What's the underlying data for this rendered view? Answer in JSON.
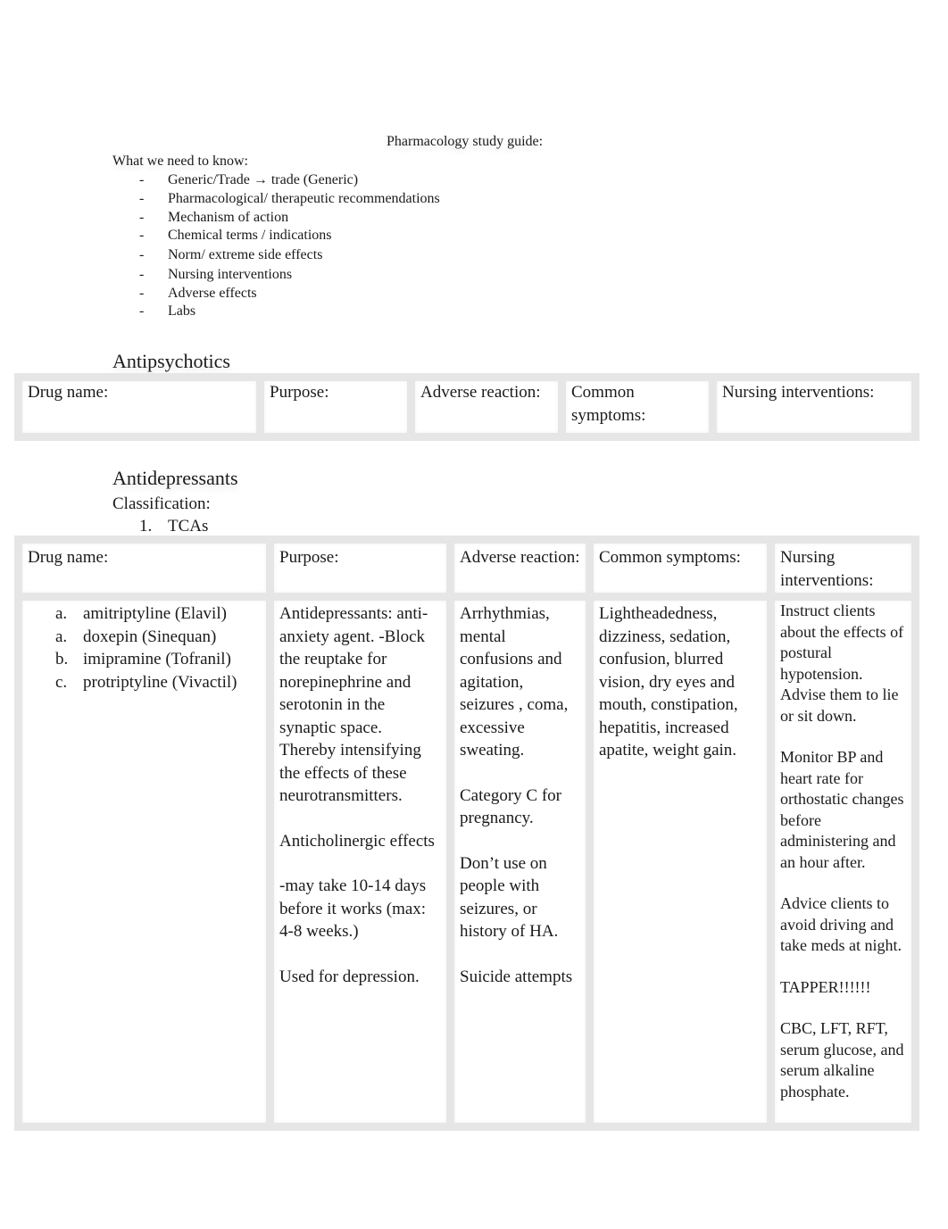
{
  "document": {
    "title": "Pharmacology study guide:",
    "need_heading": "What we need to know:",
    "need_items": [
      {
        "marker": "-",
        "text": "Generic/Trade → trade (Generic)"
      },
      {
        "marker": "-",
        "text": "Pharmacological/ therapeutic recommendations"
      },
      {
        "marker": "-",
        "text": "Mechanism of action"
      },
      {
        "marker": "-",
        "text": "Chemical terms / indications"
      },
      {
        "marker": "-",
        "text": "Norm/ extreme side effects"
      },
      {
        "marker": "-",
        "text": "Nursing interventions"
      },
      {
        "marker": "-",
        "text": "Adverse effects"
      },
      {
        "marker": "-",
        "text": "Labs"
      }
    ]
  },
  "antipsychotics": {
    "heading": "Antipsychotics",
    "table": {
      "headers": [
        "Drug name:",
        "Purpose:",
        "Adverse reaction:",
        "Common symptoms:",
        "Nursing interventions:"
      ]
    }
  },
  "antidepressants": {
    "heading": "Antidepressants",
    "classification_label": "Classification:",
    "classification_item": {
      "number": "1.",
      "text": "TCAs"
    },
    "table": {
      "headers": [
        "Drug name:",
        "Purpose:",
        "Adverse reaction:",
        "Common symptoms:",
        "Nursing interventions:"
      ],
      "drugs": [
        {
          "marker": "a.",
          "name": "amitriptyline (Elavil)"
        },
        {
          "marker": "a.",
          "name": "doxepin (Sinequan)"
        },
        {
          "marker": "b.",
          "name": "imipramine (Tofranil)"
        },
        {
          "marker": "c.",
          "name": "protriptyline (Vivactil)"
        }
      ],
      "purpose": [
        "Antidepressants: anti-anxiety agent. -Block the reuptake for norepinephrine and serotonin in the synaptic space. Thereby intensifying the effects of these neurotransmitters.",
        "Anticholinergic effects",
        "-may take 10-14 days before it works (max: 4-8 weeks.)",
        "Used for depression."
      ],
      "adverse_reaction": [
        "Arrhythmias, mental confusions and agitation, seizures , coma, excessive sweating.",
        "Category C for pregnancy.",
        "Don’t use on people with seizures, or history of HA.",
        "Suicide attempts"
      ],
      "common_symptoms": [
        "Lightheadedness, dizziness, sedation, confusion,  blurred vision, dry eyes and mouth, constipation, hepatitis, increased apatite, weight gain."
      ],
      "nursing_interventions": [
        "Instruct clients about the effects of postural hypotension. Advise them to lie or sit down.",
        "Monitor BP and heart rate for orthostatic changes before administering and an hour after.",
        "Advice clients to avoid driving and take meds at night.",
        "TAPPER!!!!!!",
        "CBC, LFT, RFT, serum glucose, and serum alkaline phosphate."
      ]
    }
  }
}
